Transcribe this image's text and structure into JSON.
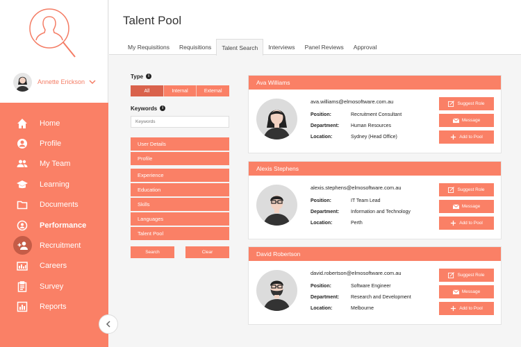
{
  "user": {
    "name": "Annette Erickson"
  },
  "nav": [
    {
      "label": "Home",
      "icon": "home-icon"
    },
    {
      "label": "Profile",
      "icon": "profile-icon"
    },
    {
      "label": "My Team",
      "icon": "team-icon"
    },
    {
      "label": "Learning",
      "icon": "graduation-cap-icon"
    },
    {
      "label": "Documents",
      "icon": "folder-icon"
    },
    {
      "label": "Performance",
      "icon": "performance-icon"
    },
    {
      "label": "Recruitment",
      "icon": "add-user-icon"
    },
    {
      "label": "Careers",
      "icon": "careers-icon"
    },
    {
      "label": "Survey",
      "icon": "clipboard-icon"
    },
    {
      "label": "Reports",
      "icon": "bar-chart-icon"
    }
  ],
  "header": {
    "title": "Talent Pool",
    "tabs": [
      "My Requisitions",
      "Requisitions",
      "Talent Search",
      "Interviews",
      "Panel Reviews",
      "Approval"
    ],
    "active_tab": "Talent Search"
  },
  "filters": {
    "type_label": "Type",
    "type_options": [
      "All",
      "Internal",
      "External"
    ],
    "type_selected": "All",
    "keywords_label": "Keywords",
    "keywords_placeholder": "Keywords",
    "keywords_value": "",
    "group1": [
      "User Details",
      "Profile"
    ],
    "group2": [
      "Experience",
      "Education",
      "Skills",
      "Languages",
      "Talent Pool"
    ],
    "search_label": "Search",
    "clear_label": "Clear"
  },
  "labels": {
    "position": "Position:",
    "department": "Department:",
    "location": "Location:",
    "suggest": "Suggest Role",
    "message": "Message",
    "add": "Add to Pool"
  },
  "candidates": [
    {
      "name": "Ava Williams",
      "email": "ava.williams@elmosoftware.com.au",
      "position": "Recruitment Consultant",
      "department": "Human Resources",
      "location": "Sydney (Head Office)"
    },
    {
      "name": "Alexis Stephens",
      "email": "alexis.stephens@elmosoftware.com.au",
      "position": "IT Team Lead",
      "department": "Information and Technology",
      "location": "Perth"
    },
    {
      "name": "David Robertson",
      "email": "david.robertson@elmosoftware.com.au",
      "position": "Software Engineer",
      "department": "Research and Development",
      "location": "Melbourne"
    }
  ],
  "colors": {
    "accent": "#fa8066",
    "accent_dark": "#d9624c",
    "active_nav": "#c55c47"
  }
}
